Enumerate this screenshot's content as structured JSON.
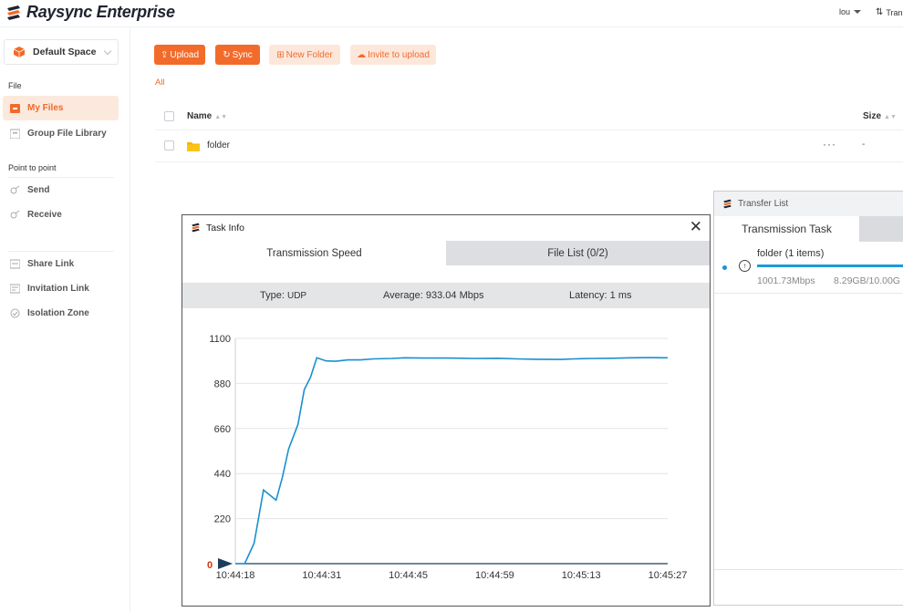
{
  "brand": {
    "name": "Raysync Enterprise"
  },
  "header": {
    "user": "lou",
    "transfer": "Tran"
  },
  "sidebar": {
    "space": "Default Space",
    "sections": [
      {
        "title": "File",
        "items": [
          {
            "label": "My Files",
            "icon": "my-files-icon",
            "active": true
          },
          {
            "label": "Group File Library",
            "icon": "group-library-icon",
            "active": false
          }
        ]
      },
      {
        "title": "Point to point",
        "items": [
          {
            "label": "Send",
            "icon": "send-icon",
            "active": false
          },
          {
            "label": "Receive",
            "icon": "receive-icon",
            "active": false
          }
        ]
      },
      {
        "title": "",
        "items": [
          {
            "label": "Share Link",
            "icon": "share-link-icon",
            "active": false
          },
          {
            "label": "Invitation Link",
            "icon": "invitation-link-icon",
            "active": false
          },
          {
            "label": "Isolation Zone",
            "icon": "isolation-zone-icon",
            "active": false
          }
        ]
      }
    ]
  },
  "toolbar": {
    "upload": "Upload",
    "sync": "Sync",
    "new_folder": "New Folder",
    "invite": "Invite to upload"
  },
  "breadcrumb": "All",
  "table": {
    "columns": {
      "name": "Name",
      "size": "Size"
    },
    "rows": [
      {
        "name": "folder",
        "more": "···",
        "size": "-"
      }
    ]
  },
  "transfer_list": {
    "title": "Transfer List",
    "tab": "Transmission Task",
    "task": {
      "name": "folder  (1 items)",
      "speed": "1001.73Mbps",
      "size": "8.29GB/10.00G",
      "progress": 0.83
    }
  },
  "task_info": {
    "title": "Task Info",
    "tabs": [
      "Transmission Speed",
      "File List (0/2)"
    ],
    "stats": {
      "type_label": "Type:",
      "type_value": "UDP",
      "average_label": "Average:",
      "average_value": "933.04 Mbps",
      "latency_label": "Latency:",
      "latency_value": "1 ms"
    }
  },
  "colors": {
    "accent": "#f26b2b",
    "line": "#1a8fd1",
    "active_bg": "#fbe9dd"
  },
  "chart_data": {
    "type": "line",
    "title": "",
    "xlabel": "",
    "ylabel": "",
    "ylim": [
      0,
      1100
    ],
    "yticks": [
      0,
      220,
      440,
      660,
      880,
      1100
    ],
    "xticks": [
      "10:44:18",
      "10:44:31",
      "10:44:45",
      "10:44:59",
      "10:45:13",
      "10:45:27"
    ],
    "x_seconds_range": [
      0,
      69
    ],
    "series": [
      {
        "values": [
          [
            0,
            0
          ],
          [
            1.5,
            0
          ],
          [
            3,
            100
          ],
          [
            4.5,
            360
          ],
          [
            6.5,
            310
          ],
          [
            7.5,
            420
          ],
          [
            8.5,
            560
          ],
          [
            10,
            680
          ],
          [
            11,
            850
          ],
          [
            12,
            910
          ],
          [
            13,
            1005
          ],
          [
            14.5,
            990
          ],
          [
            16,
            988
          ],
          [
            18,
            995
          ],
          [
            20,
            995
          ],
          [
            22,
            1000
          ],
          [
            25,
            1002
          ],
          [
            27,
            1005
          ],
          [
            30,
            1004
          ],
          [
            34,
            1004
          ],
          [
            38,
            1002
          ],
          [
            42,
            1003
          ],
          [
            45,
            1000
          ],
          [
            48,
            998
          ],
          [
            52,
            997
          ],
          [
            54,
            1000
          ],
          [
            57,
            1002
          ],
          [
            60,
            1003
          ],
          [
            63,
            1005
          ],
          [
            66,
            1006
          ],
          [
            69,
            1005
          ]
        ]
      }
    ],
    "zero_marker": "0",
    "grid": true
  }
}
